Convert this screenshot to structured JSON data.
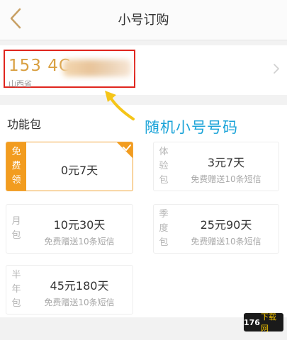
{
  "header": {
    "title": "小号订购",
    "back_icon": "chevron-left-icon"
  },
  "number_card": {
    "number_prefix": "153 4C",
    "province": "山西省",
    "chevron_icon": "chevron-right-icon",
    "highlight_color": "#e0261e"
  },
  "annotation": {
    "text": "随机小号号码",
    "color": "#1aa3d8",
    "arrow_icon": "arrow-icon"
  },
  "section": {
    "title": "功能包"
  },
  "packages": [
    {
      "side": [
        "免",
        "费",
        "领"
      ],
      "name": "0元7天",
      "desc": "",
      "selected": true
    },
    {
      "side": [
        "体",
        "验",
        "包"
      ],
      "name": "3元7天",
      "desc": "免费赠送10条短信",
      "selected": false
    },
    {
      "side": [
        "月",
        "包"
      ],
      "name": "10元30天",
      "desc": "免费赠送10条短信",
      "selected": false
    },
    {
      "side": [
        "季",
        "度",
        "包"
      ],
      "name": "25元90天",
      "desc": "免费赠送10条短信",
      "selected": false
    },
    {
      "side": [
        "半",
        "年",
        "包"
      ],
      "name": "45元180天",
      "desc": "免费赠送10条短信",
      "selected": false
    }
  ],
  "colors": {
    "accent": "#f29c1f",
    "number_text": "#d9a042"
  },
  "watermark": {
    "part1": "176",
    "part2": "下载网"
  }
}
